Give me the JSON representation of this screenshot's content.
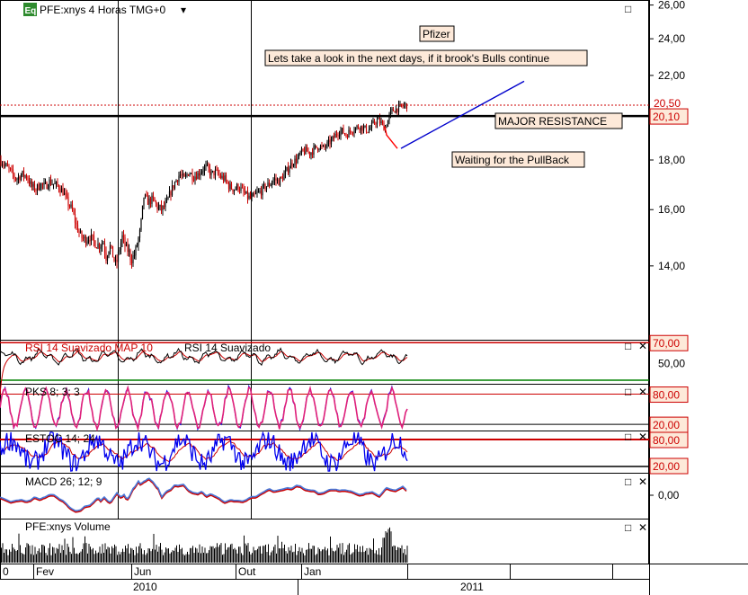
{
  "header": {
    "badge": "Eq",
    "title": "PFE:xnys 4 Horas TMG+0",
    "dropdown_glyph": "▾"
  },
  "colors": {
    "up": "#000000",
    "down": "#cc0000",
    "resistance": "#000000",
    "trend": "#0000cc",
    "pullback": "#ff0000",
    "label_bg": "#fde9d9",
    "level_red": "#cc0000",
    "level_green": "#008000",
    "pink": "#e0207a",
    "blue": "#0000ee"
  },
  "chart_data": [
    {
      "type": "line",
      "subtype": "candlestick",
      "name": "price",
      "y_ticks": [
        "26,00",
        "24,00",
        "22,00",
        "20,00",
        "18,00",
        "16,00",
        "14,00"
      ],
      "y_tick_values": [
        26,
        24,
        22,
        20,
        18,
        16,
        14
      ],
      "ylim": [
        11.8,
        26.2
      ],
      "log_scale": true,
      "resistance": {
        "value": 19.98,
        "label": "MAJOR RESISTANCE",
        "price_tag": "20,10"
      },
      "dotted_level": {
        "value": 20.5,
        "price_tag": "20,50"
      },
      "annotations": [
        {
          "text": "Pfizer"
        },
        {
          "text": "Lets take a look in the next days, if it brook's  Bulls continue"
        },
        {
          "text": "Waiting for the PullBack"
        }
      ],
      "anchors": [
        [
          0,
          18.0
        ],
        [
          10,
          17.6
        ],
        [
          18,
          17.2
        ],
        [
          25,
          17.4
        ],
        [
          30,
          17.3
        ],
        [
          35,
          16.9
        ],
        [
          40,
          16.8
        ],
        [
          45,
          17.0
        ],
        [
          50,
          16.9
        ],
        [
          55,
          17.1
        ],
        [
          60,
          17.0
        ],
        [
          65,
          16.9
        ],
        [
          70,
          16.7
        ],
        [
          75,
          16.3
        ],
        [
          80,
          16.0
        ],
        [
          85,
          15.4
        ],
        [
          90,
          15.0
        ],
        [
          95,
          14.9
        ],
        [
          100,
          15.0
        ],
        [
          105,
          14.8
        ],
        [
          110,
          14.7
        ],
        [
          115,
          14.8
        ],
        [
          118,
          14.3
        ],
        [
          122,
          14.7
        ],
        [
          126,
          14.3
        ],
        [
          129,
          14.0
        ],
        [
          133,
          14.6
        ],
        [
          136,
          15.0
        ],
        [
          140,
          14.6
        ],
        [
          143,
          14.5
        ],
        [
          146,
          14.2
        ],
        [
          150,
          14.4
        ],
        [
          153,
          14.8
        ],
        [
          156,
          15.2
        ],
        [
          160,
          16.5
        ],
        [
          165,
          16.3
        ],
        [
          170,
          16.4
        ],
        [
          175,
          16.1
        ],
        [
          180,
          16.0
        ],
        [
          185,
          16.2
        ],
        [
          190,
          16.7
        ],
        [
          195,
          17.1
        ],
        [
          200,
          17.4
        ],
        [
          205,
          17.2
        ],
        [
          210,
          17.5
        ],
        [
          215,
          17.3
        ],
        [
          220,
          17.4
        ],
        [
          225,
          17.6
        ],
        [
          230,
          17.7
        ],
        [
          235,
          17.4
        ],
        [
          240,
          17.5
        ],
        [
          245,
          17.3
        ],
        [
          250,
          17.2
        ],
        [
          255,
          16.9
        ],
        [
          260,
          16.8
        ],
        [
          265,
          16.9
        ],
        [
          270,
          16.7
        ],
        [
          275,
          16.5
        ],
        [
          280,
          16.4
        ],
        [
          285,
          16.6
        ],
        [
          290,
          16.7
        ],
        [
          295,
          16.9
        ],
        [
          300,
          17.0
        ],
        [
          305,
          17.2
        ],
        [
          310,
          17.1
        ],
        [
          315,
          17.3
        ],
        [
          320,
          17.6
        ],
        [
          325,
          17.9
        ],
        [
          330,
          18.0
        ],
        [
          335,
          18.3
        ],
        [
          340,
          18.4
        ],
        [
          345,
          18.3
        ],
        [
          350,
          18.5
        ],
        [
          355,
          18.6
        ],
        [
          360,
          18.5
        ],
        [
          365,
          18.7
        ],
        [
          370,
          18.9
        ],
        [
          375,
          19.2
        ],
        [
          380,
          19.3
        ],
        [
          385,
          19.1
        ],
        [
          390,
          19.3
        ],
        [
          395,
          19.4
        ],
        [
          400,
          19.5
        ],
        [
          405,
          19.4
        ],
        [
          410,
          19.3
        ],
        [
          415,
          19.6
        ],
        [
          420,
          19.8
        ],
        [
          425,
          19.6
        ],
        [
          428,
          19.4
        ],
        [
          431,
          19.7
        ],
        [
          435,
          20.2
        ],
        [
          440,
          20.3
        ],
        [
          445,
          20.4
        ],
        [
          450,
          20.5
        ],
        [
          453,
          20.5
        ]
      ],
      "pullback_line": [
        [
          428,
          19.5
        ],
        [
          430,
          19.1
        ],
        [
          442,
          18.5
        ]
      ],
      "trend_line": [
        [
          446,
          18.5
        ],
        [
          583,
          21.7
        ]
      ]
    },
    {
      "type": "line",
      "name": "RSI",
      "label_red": "RSI 14 Suavizado MAP 10",
      "label_black": "RSI 14 Suavizado",
      "levels": [
        "70,00",
        "50,00"
      ],
      "level_values": [
        70,
        50
      ],
      "green_level": 30,
      "ylim": [
        30,
        72
      ]
    },
    {
      "type": "line",
      "name": "PKS",
      "label": "PKS 8; 3; 3",
      "levels": [
        "80,00",
        "20,00"
      ],
      "level_values": [
        80,
        20
      ],
      "ylim": [
        5,
        100
      ]
    },
    {
      "type": "line",
      "name": "ESTOC",
      "label": "ESTOC 14; 24",
      "levels": [
        "80,00",
        "20,00"
      ],
      "level_values": [
        80,
        20
      ],
      "ylim": [
        0,
        100
      ]
    },
    {
      "type": "line",
      "name": "MACD",
      "label": "MACD 26; 12; 9",
      "levels": [
        "0,00"
      ],
      "level_values": [
        0
      ]
    },
    {
      "type": "bar",
      "name": "volume",
      "label": "PFE:xnys Volume"
    }
  ],
  "x_axis": {
    "months": [
      {
        "label": "0",
        "x": 0
      },
      {
        "label": "Fev",
        "x": 37
      },
      {
        "label": "Jun",
        "x": 146
      },
      {
        "label": "Out",
        "x": 262
      },
      {
        "label": "Jan",
        "x": 335
      }
    ],
    "years": [
      "2010",
      "2011"
    ]
  },
  "pane_controls": {
    "maximize": "□",
    "close": "✕"
  }
}
